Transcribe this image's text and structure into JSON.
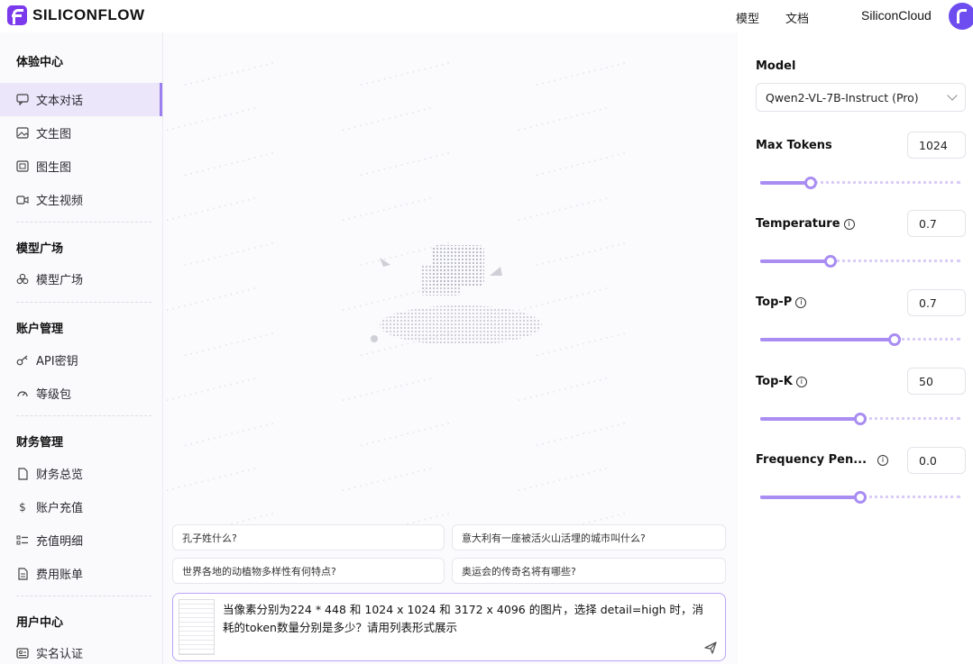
{
  "header": {
    "brand": "SILICONFLOW",
    "nav": [
      "模型",
      "文档"
    ],
    "cloud": "SiliconCloud"
  },
  "sidebar": {
    "sections": [
      {
        "title": "体验中心",
        "items": [
          {
            "label": "文本对话",
            "icon": "chat-icon",
            "active": true
          },
          {
            "label": "文生图",
            "icon": "image-icon"
          },
          {
            "label": "图生图",
            "icon": "image-to-image-icon"
          },
          {
            "label": "文生视频",
            "icon": "video-icon"
          }
        ]
      },
      {
        "title": "模型广场",
        "items": [
          {
            "label": "模型广场",
            "icon": "cubes-icon"
          }
        ]
      },
      {
        "title": "账户管理",
        "items": [
          {
            "label": "API密钥",
            "icon": "key-icon"
          },
          {
            "label": "等级包",
            "icon": "gauge-icon"
          }
        ]
      },
      {
        "title": "财务管理",
        "items": [
          {
            "label": "财务总览",
            "icon": "document-icon"
          },
          {
            "label": "账户充值",
            "icon": "dollar-icon"
          },
          {
            "label": "充值明细",
            "icon": "list-icon"
          },
          {
            "label": "费用账单",
            "icon": "bill-icon"
          }
        ]
      },
      {
        "title": "用户中心",
        "items": [
          {
            "label": "实名认证",
            "icon": "id-card-icon"
          }
        ]
      }
    ]
  },
  "main": {
    "suggestions": [
      "孔子姓什么?",
      "意大利有一座被活火山活埋的城市叫什么?",
      "世界各地的动植物多样性有何特点?",
      "奥运会的传奇名将有哪些?"
    ],
    "composer_text": "当像素分别为224 * 448 和 1024 x 1024 和 3172 x 4096 的图片，选择 detail=high 时，消耗的token数量分别是多少？请用列表形式展示"
  },
  "panel": {
    "model_label": "Model",
    "model_value": "Qwen2-VL-7B-Instruct (Pro)",
    "params": [
      {
        "label": "Max Tokens",
        "value": "1024",
        "info": false,
        "level": 0.25
      },
      {
        "label": "Temperature",
        "value": "0.7",
        "info": true,
        "level": 0.35
      },
      {
        "label": "Top-P",
        "value": "0.7",
        "info": true,
        "level": 0.67
      },
      {
        "label": "Top-K",
        "value": "50",
        "info": true,
        "level": 0.5
      },
      {
        "label": "Frequency Pen...",
        "value": "0.0",
        "info": true,
        "level": 0.5
      }
    ]
  },
  "colors": {
    "accent": "#a98df2",
    "active_bg": "#ece6fb",
    "brand": "#6d4cf0"
  }
}
